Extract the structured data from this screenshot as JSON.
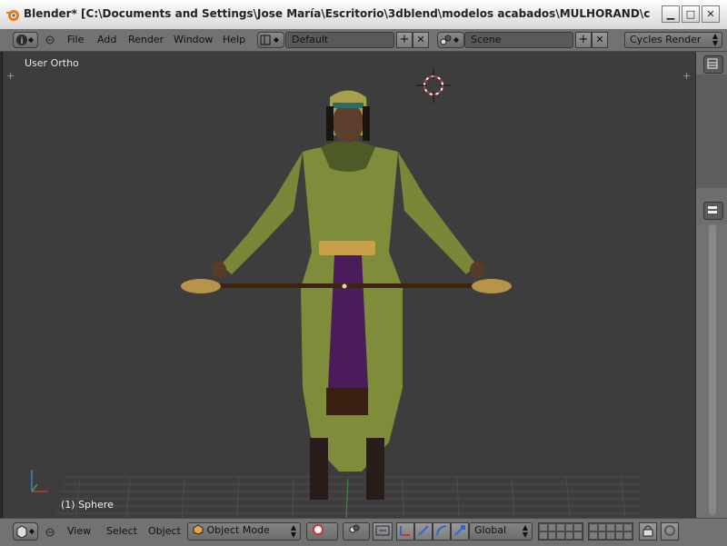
{
  "window": {
    "title": "Blender* [C:\\Documents and Settings\\Jose María\\Escritorio\\3dblend\\modelos acabados\\MULHORAND\\clerigos\\c...",
    "minimize_glyph": "▁",
    "maximize_glyph": "□",
    "close_glyph": "✕"
  },
  "header": {
    "menus": [
      "File",
      "Add",
      "Render",
      "Window",
      "Help"
    ],
    "screen_layout": "Default",
    "scene": "Scene",
    "render_engine": "Cycles Render",
    "add_glyph": "+",
    "remove_glyph": "✕"
  },
  "viewport": {
    "view_label": "User Ortho",
    "object_label": "(1) Sphere"
  },
  "footer": {
    "menus": [
      "View",
      "Select",
      "Object"
    ],
    "mode": "Object Mode",
    "orientation": "Global"
  },
  "colors": {
    "accent": "#e87d0d",
    "robe_green": "#7f8c3a",
    "sash_purple": "#4a1c5c",
    "gold": "#c9a04a"
  }
}
